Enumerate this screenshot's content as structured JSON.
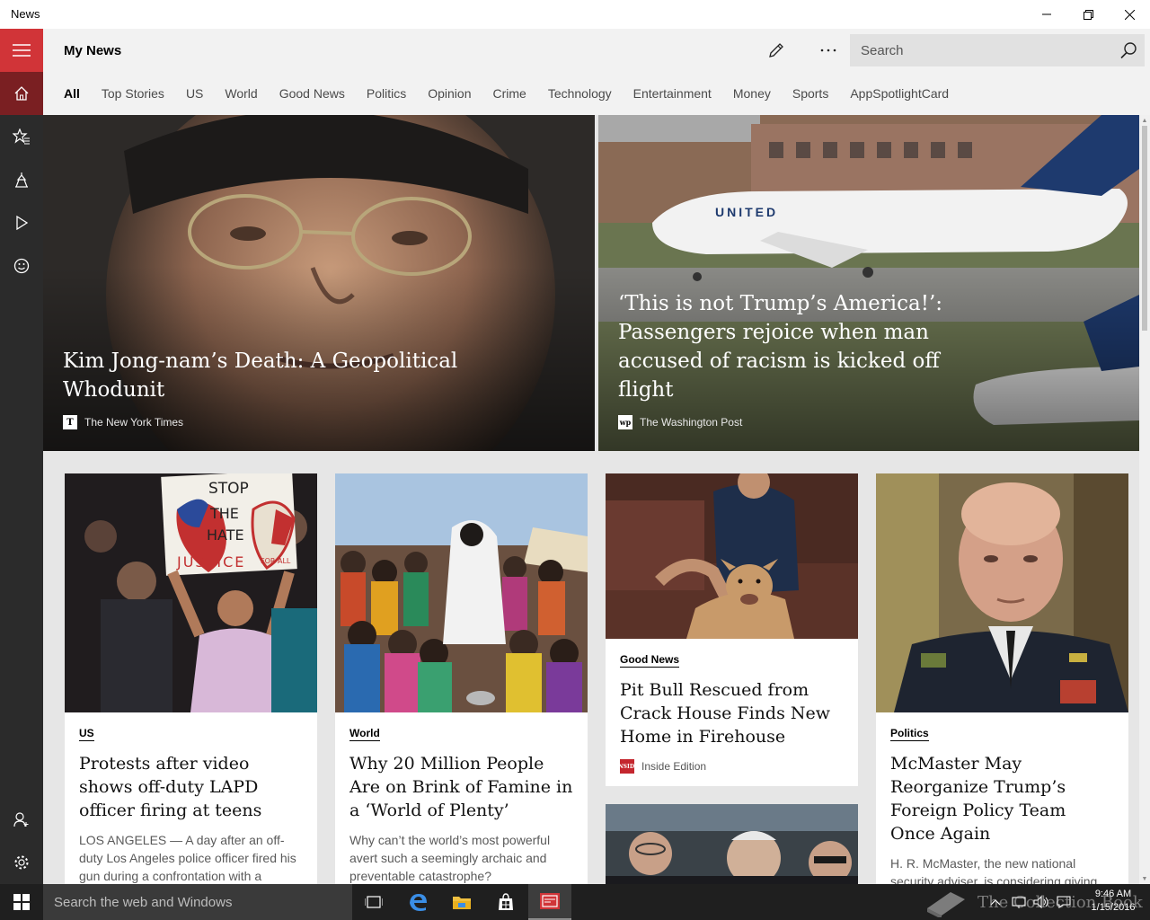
{
  "window": {
    "title": "News",
    "controls": [
      "minimize",
      "restore",
      "close"
    ]
  },
  "rail": {
    "items": [
      {
        "icon": "hamburger-menu-icon"
      },
      {
        "icon": "home-icon",
        "active": true
      },
      {
        "icon": "favorites-star-icon"
      },
      {
        "icon": "local-landmark-icon"
      },
      {
        "icon": "video-play-icon"
      },
      {
        "icon": "sports-smile-icon"
      }
    ],
    "bottom": [
      {
        "icon": "add-account-icon"
      },
      {
        "icon": "settings-gear-icon"
      }
    ],
    "accent": "#d13438"
  },
  "header": {
    "title": "My News",
    "search_placeholder": "Search"
  },
  "tabs": [
    "All",
    "Top Stories",
    "US",
    "World",
    "Good News",
    "Politics",
    "Opinion",
    "Crime",
    "Technology",
    "Entertainment",
    "Money",
    "Sports",
    "AppSpotlightCard"
  ],
  "hero": [
    {
      "title": "Kim Jong-nam’s Death: A Geopolitical Whodunit",
      "source": "The New York Times",
      "logo": "T"
    },
    {
      "title": "‘This is not Trump’s America!’: Passengers rejoice when man accused of racism is kicked off flight",
      "source": "The Washington Post",
      "logo": "wp"
    }
  ],
  "cards": [
    {
      "category": "US",
      "title": "Protests after video shows off-duty LAPD officer firing at teens",
      "summary": "LOS ANGELES — A day after an off-duty Los Angeles police officer fired his gun during a confrontation with a",
      "image_text": [
        "STOP",
        "THE",
        "HATE",
        "JUSTICE",
        "FOR ALL"
      ]
    },
    {
      "category": "World",
      "title": "Why 20 Million People Are on Brink of Famine in a ‘World of Plenty’",
      "summary": "Why can’t the world’s most powerful avert such a seemingly archaic and preventable catastrophe?"
    },
    {
      "category": "Good News",
      "title": "Pit Bull Rescued from Crack House Finds New Home in Firehouse",
      "source": "Inside Edition",
      "logo": "INSIDE"
    },
    {
      "category": "Politics",
      "title": "McMaster May Reorganize Trump’s Foreign Policy Team Once Again",
      "summary": "H. R. McMaster, the new national security adviser, is considering giving himself control of Homeland Security"
    }
  ],
  "taskbar": {
    "search_placeholder": "Search the web and Windows",
    "apps": [
      "task-view-icon",
      "edge-browser-icon",
      "file-explorer-icon",
      "store-icon",
      "news-app-icon"
    ],
    "time": "9:46 AM",
    "date": "1/15/2016",
    "watermark": "The Collection Book"
  }
}
